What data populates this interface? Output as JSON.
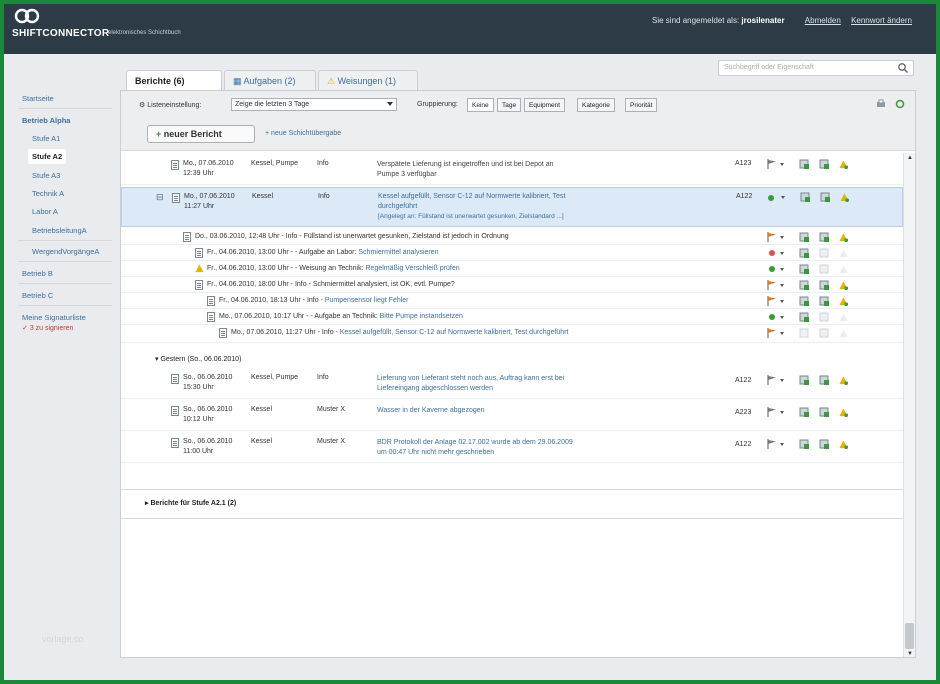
{
  "app": {
    "brand": "SHIFTCONNECTOR",
    "brand_sub": "elektronisches Schichtbuch",
    "logged_in_text": "Sie sind angemeldet als:",
    "user": "jrosilenater",
    "logout": "Abmelden",
    "password": "Kennwort ändern"
  },
  "search": {
    "placeholder": "Suchbegriff oder Eigenschaft"
  },
  "sidebar": {
    "start": "Startseite",
    "betrieb": "Betrieb Alpha",
    "stufe_a1": "Stufe A1",
    "stufe_a2": "Stufe A2",
    "stufe_a3": "Stufe A3",
    "technik": "Technik A",
    "labor": "Labor A",
    "betriebsleitung": "BetriebsleitungA",
    "wirgen": "WergendVorgängeA",
    "betrieb_b": "Betrieb B",
    "betrieb_c": "Betrieb C",
    "signatur": "Meine Signaturliste",
    "alert": "3 zu signieren",
    "watermark": "vorlage.co"
  },
  "tabs": {
    "berichte": "Berichte (6)",
    "aufgaben": "Aufgaben (2)",
    "weisungen": "Weisungen (1)"
  },
  "toolbar": {
    "listen_label": "Listeneinstellung:",
    "listen_value": "Zeige die letzten 3 Tage",
    "grp_label": "Gruppierung:",
    "grp_keine": "Keine",
    "grp_tage": "Tage",
    "grp_equipment": "Equipment",
    "grp_kategorie": "Kategorie",
    "grp_prioritaet": "Priorität",
    "new_button": "neuer Bericht",
    "new_link": "neue Schichtübergabe"
  },
  "rows": [
    {
      "date": "Mo., 07.06.2010",
      "time": "12:39 Uhr",
      "equip": "Kessel, Pumpe",
      "cat": "Info",
      "line1": "Verspätete Lieferung ist eingetroffen und ist bei Depot an",
      "line2": "Pumpe 3 verfügbar",
      "area": "A123"
    },
    {
      "date": "Mo., 07.06.2010",
      "time": "11:27 Uhr",
      "equip": "Kessel",
      "cat": "Info",
      "line1": "Kessel aufgefüllt, Sensor C-12 auf Normwerte kalibriert, Test",
      "line2": "durchgeführt",
      "line3": "[Angelegt an: Füllstand ist unerwartet gesunken, Zielstandard ...]",
      "area": "A122"
    }
  ],
  "sub_rows": [
    {
      "text": "Do., 03.06.2010, 12:48 Uhr - Info - Füllstand ist unerwartet gesunken, Zielstand ist jedoch in Ordnung"
    },
    {
      "prefix": "Fr., 04.06.2010, 13:00 Uhr - - Aufgabe an Labor: ",
      "link": "Schmiermittel analysieren"
    },
    {
      "prefix": "Fr., 04.06.2010, 13:00 Uhr - - Weisung an Technik: ",
      "link": "Regelmäßig Verschleiß prüfen"
    },
    {
      "text": "Fr., 04.06.2010, 18:00 Uhr - Info - Schmiermittel analysiert, ist OK, evtl. Pumpe?"
    },
    {
      "prefix": "Fr., 04.06.2010, 18:13 Uhr - Info - ",
      "link": "Pumpensensor liegt Fehler"
    },
    {
      "prefix": "Mo., 07.06.2010, 10:17 Uhr - - Aufgabe an Technik: ",
      "link": "Bitte Pumpe instandsetzen"
    },
    {
      "prefix": "Mo., 07.06.2010, 11:27 Uhr - Info - ",
      "link": "Kessel aufgefüllt, Sensor C-12 auf Normwerte kalibriert, Test durchgeführt"
    }
  ],
  "group_gestern": "Gestern (So., 06.06.2010)",
  "rows2": [
    {
      "date": "So., 06.06.2010",
      "time": "15:30 Uhr",
      "equip": "Kessel, Pumpe",
      "cat": "Info",
      "line1": "Lieferung von Lieferant steht noch aus, Auftrag kann erst bei",
      "line2": "Liefereingang abgeschlossen werden",
      "area": "A122"
    },
    {
      "date": "So., 06.06.2010",
      "time": "10:12 Uhr",
      "equip": "Kessel",
      "cat": "Muster X",
      "line1": "Wasser in der Kaverne abgezogen",
      "line2": "",
      "area": "A223"
    },
    {
      "date": "So., 06.06.2010",
      "time": "11:00 Uhr",
      "equip": "Kessel",
      "cat": "Muster X",
      "line1": "BDR Protokoll der Anlage 02.17.002 wurde ab dem 29.06.2009",
      "line2": "um 00:47 Uhr nicht mehr geschrieben",
      "area": "A122"
    }
  ],
  "bottom_group": "Berichte für Stufe A2.1 (2)",
  "colors": {
    "topbar": "#2d3b47",
    "link": "#3d6f9e",
    "selected": "#dce9f6",
    "frame": "#1a8a3a"
  }
}
